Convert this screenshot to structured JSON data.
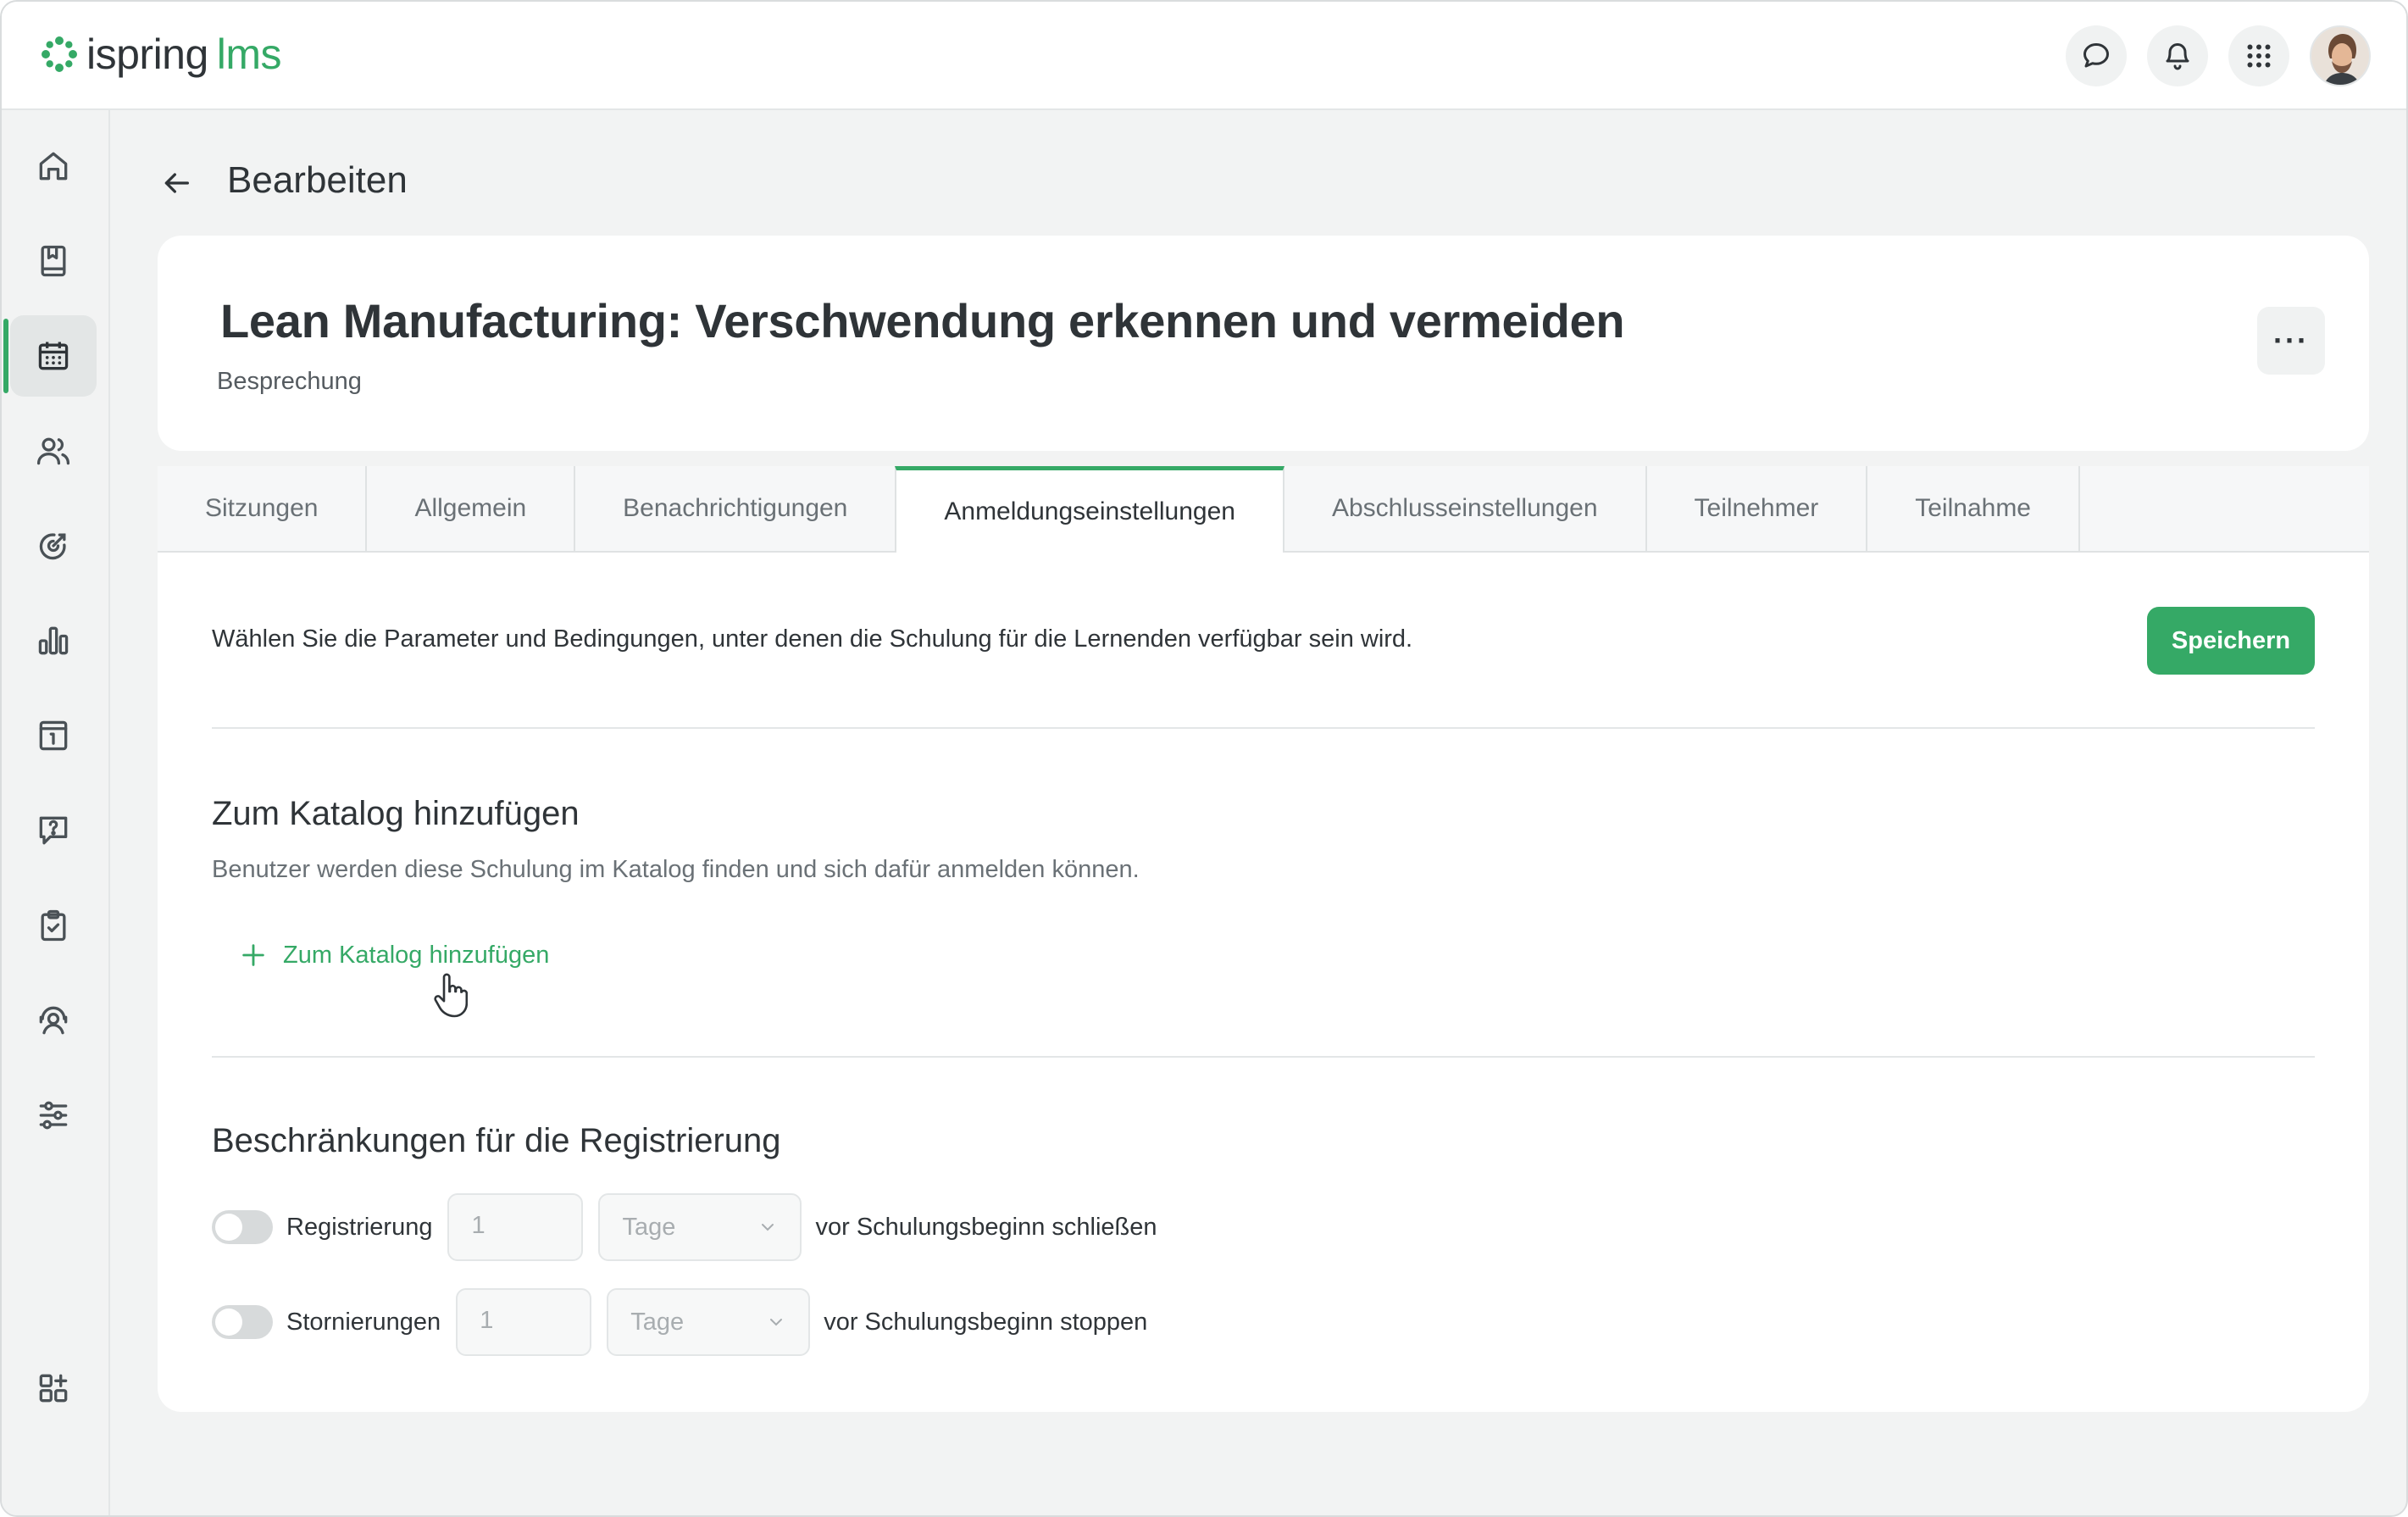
{
  "brand": {
    "name_part1": "ispring",
    "name_part2": "lms",
    "accent": "#35a966"
  },
  "topbar": {
    "icons": [
      "chat-icon",
      "bell-icon",
      "apps-grid-icon"
    ],
    "avatar": "user-avatar"
  },
  "sidebar": {
    "items": [
      {
        "name": "home",
        "icon": "home-icon",
        "active": false
      },
      {
        "name": "courses",
        "icon": "book-icon",
        "active": false
      },
      {
        "name": "calendar",
        "icon": "calendar-icon",
        "active": true
      },
      {
        "name": "users",
        "icon": "users-icon",
        "active": false
      },
      {
        "name": "goals",
        "icon": "target-icon",
        "active": false
      },
      {
        "name": "reports",
        "icon": "bar-chart-icon",
        "active": false
      },
      {
        "name": "info",
        "icon": "info-panel-icon",
        "active": false
      },
      {
        "name": "questions",
        "icon": "help-chat-icon",
        "active": false
      },
      {
        "name": "tasks",
        "icon": "clipboard-check-icon",
        "active": false
      },
      {
        "name": "support",
        "icon": "headset-icon",
        "active": false
      },
      {
        "name": "settings",
        "icon": "sliders-icon",
        "active": false
      },
      {
        "name": "add-widget",
        "icon": "add-widget-icon",
        "active": false
      }
    ]
  },
  "header": {
    "title": "Bearbeiten"
  },
  "course": {
    "title": "Lean Manufacturing: Verschwendung erkennen und vermeiden",
    "type": "Besprechung",
    "more": "···"
  },
  "tabs": [
    {
      "label": "Sitzungen",
      "active": false
    },
    {
      "label": "Allgemein",
      "active": false
    },
    {
      "label": "Benachrichtigungen",
      "active": false
    },
    {
      "label": "Anmeldungseinstellungen",
      "active": true
    },
    {
      "label": "Abschlusseinstellungen",
      "active": false
    },
    {
      "label": "Teilnehmer",
      "active": false
    },
    {
      "label": "Teilnahme",
      "active": false
    }
  ],
  "content": {
    "intro": "Wählen Sie die Parameter und Bedingungen, unter denen die Schulung für die Lernenden verfügbar sein wird.",
    "save_label": "Speichern",
    "catalog": {
      "title": "Zum Katalog hinzufügen",
      "description": "Benutzer werden diese Schulung im Katalog finden und sich dafür anmelden können.",
      "add_label": "Zum Katalog hinzufügen"
    },
    "restrictions": {
      "title": "Beschränkungen für die Registrierung",
      "rows": [
        {
          "label": "Registrierung",
          "value": "1",
          "unit": "Tage",
          "tail": "vor Schulungsbeginn schließen",
          "enabled": false
        },
        {
          "label": "Stornierungen",
          "value": "1",
          "unit": "Tage",
          "tail": "vor Schulungsbeginn stoppen",
          "enabled": false
        }
      ]
    }
  }
}
